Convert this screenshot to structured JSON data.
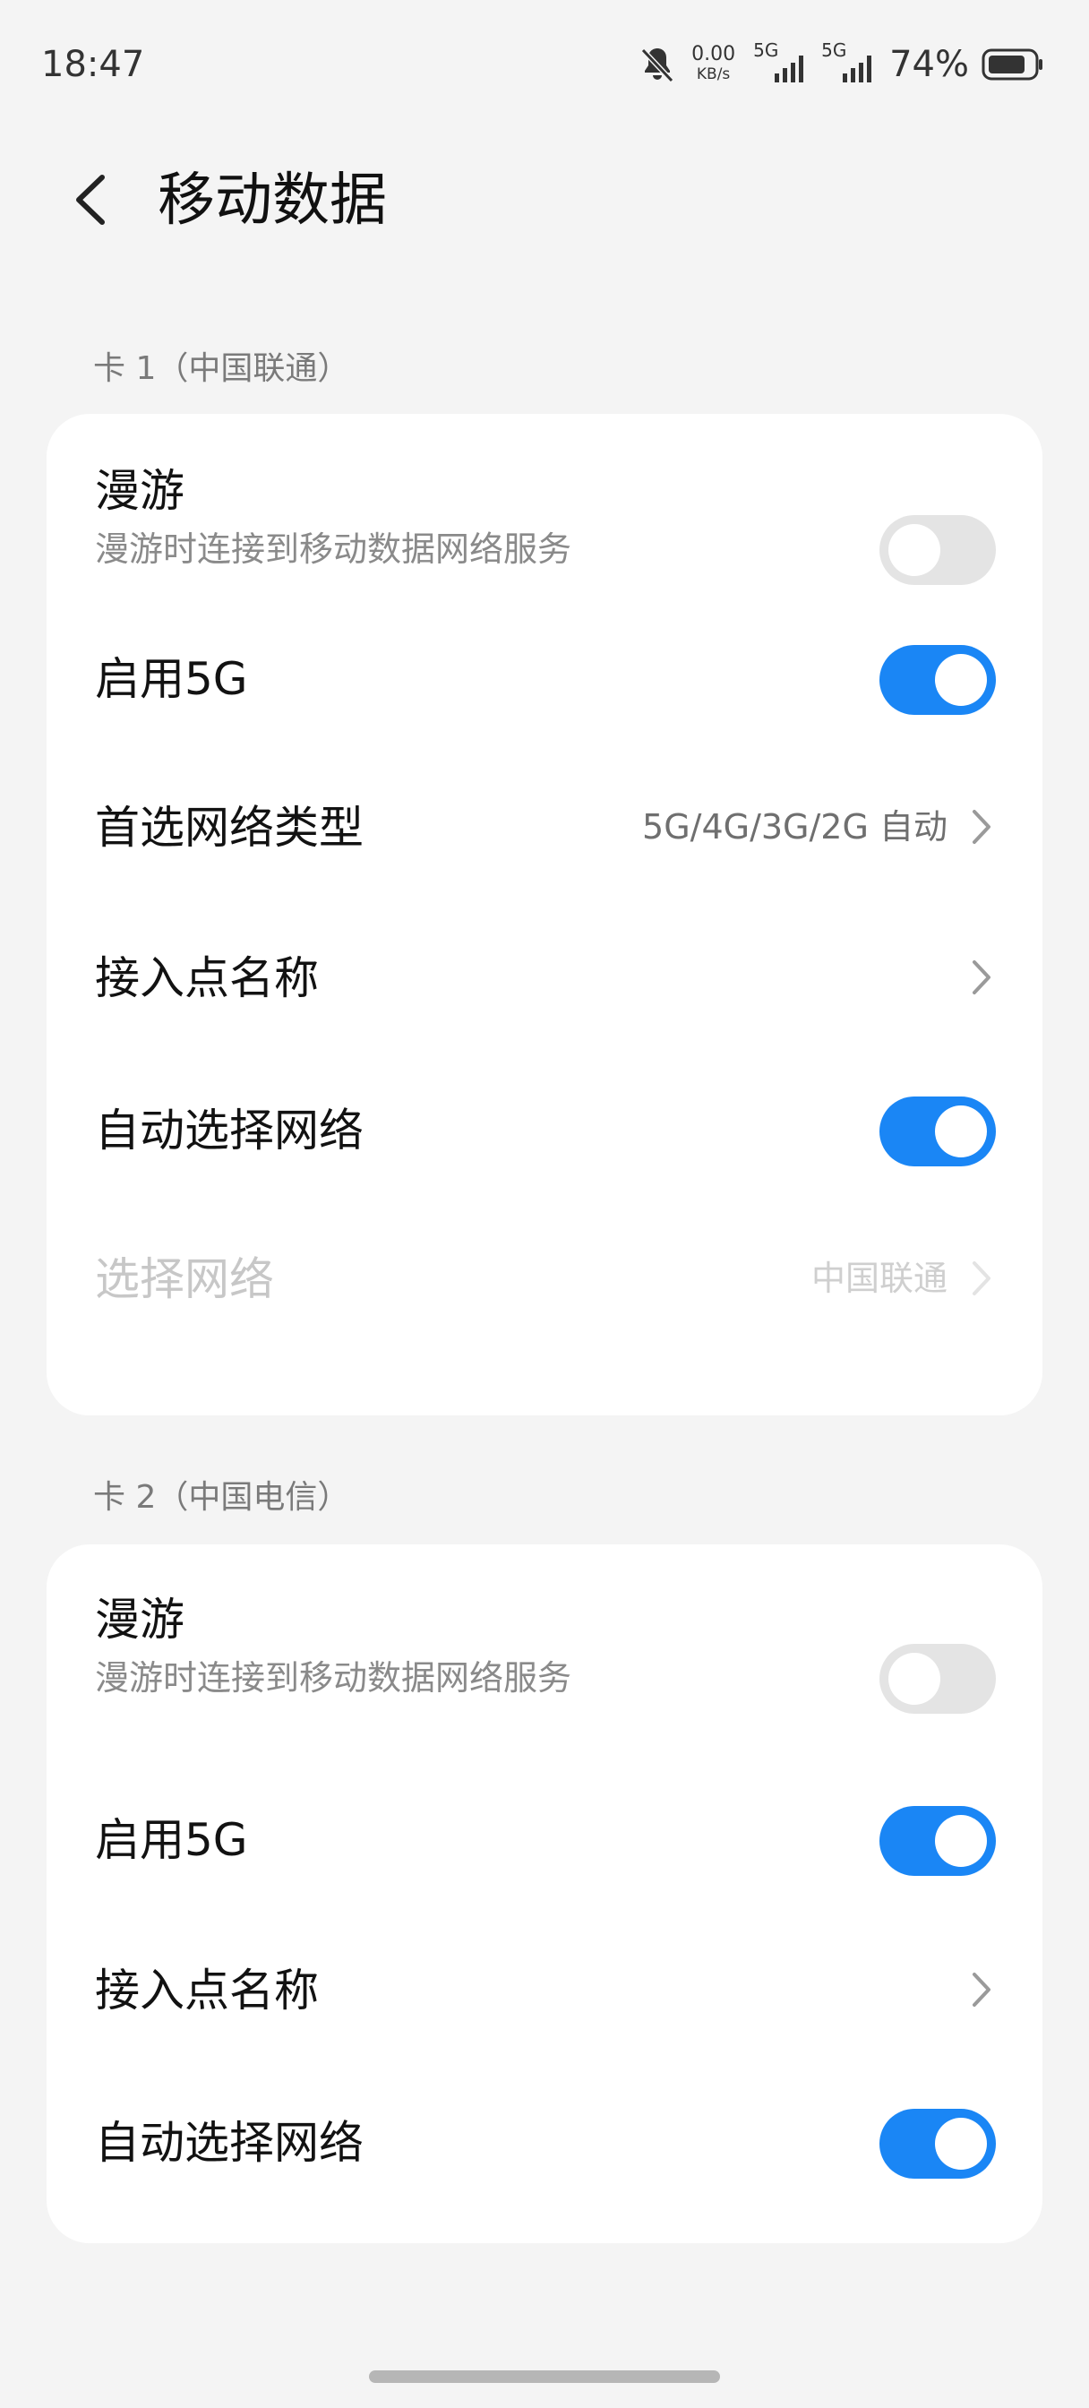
{
  "status_bar": {
    "time": "18:47",
    "net_speed_value": "0.00",
    "net_speed_unit": "KB/s",
    "sim1_tag": "5G",
    "sim2_tag": "5G",
    "battery_percent": "74%"
  },
  "header": {
    "title": "移动数据"
  },
  "sections": [
    {
      "label": "卡 1（中国联通）",
      "rows": [
        {
          "title": "漫游",
          "subtitle": "漫游时连接到移动数据网络服务",
          "control": "toggle",
          "state": "off"
        },
        {
          "title": "启用5G",
          "control": "toggle",
          "state": "on"
        },
        {
          "title": "首选网络类型",
          "value": "5G/4G/3G/2G 自动",
          "control": "chevron"
        },
        {
          "title": "接入点名称",
          "control": "chevron"
        },
        {
          "title": "自动选择网络",
          "control": "toggle",
          "state": "on"
        },
        {
          "title": "选择网络",
          "value": "中国联通",
          "control": "chevron",
          "disabled": true
        }
      ]
    },
    {
      "label": "卡 2（中国电信）",
      "rows": [
        {
          "title": "漫游",
          "subtitle": "漫游时连接到移动数据网络服务",
          "control": "toggle",
          "state": "off"
        },
        {
          "title": "启用5G",
          "control": "toggle",
          "state": "on"
        },
        {
          "title": "接入点名称",
          "control": "chevron"
        },
        {
          "title": "自动选择网络",
          "control": "toggle",
          "state": "on"
        }
      ]
    }
  ],
  "colors": {
    "accent": "#1a86f5",
    "background": "#f4f4f4",
    "card": "#ffffff"
  }
}
